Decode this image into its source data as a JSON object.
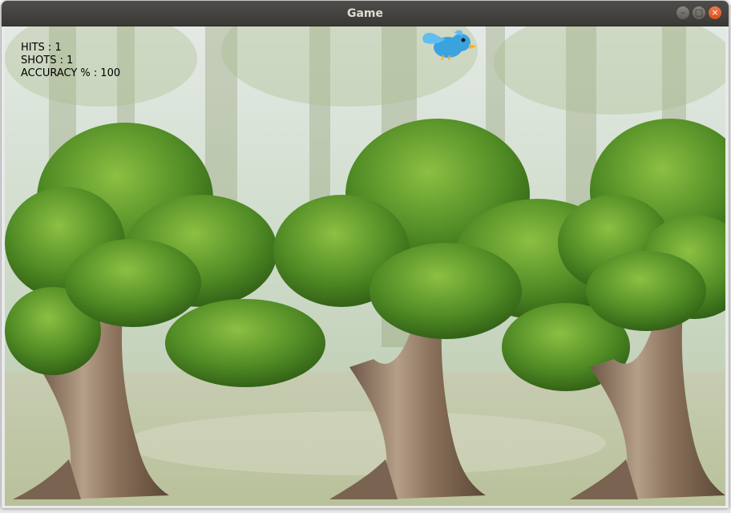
{
  "window": {
    "title": "Game"
  },
  "hud": {
    "hits_label": "HITS :",
    "hits_value": "1",
    "shots_label": "SHOTS :",
    "shots_value": "1",
    "accuracy_label": "ACCURACY % :",
    "accuracy_value": "100"
  },
  "sprites": {
    "bird": "blue-bird",
    "trees": [
      "tree",
      "tree",
      "tree"
    ]
  }
}
